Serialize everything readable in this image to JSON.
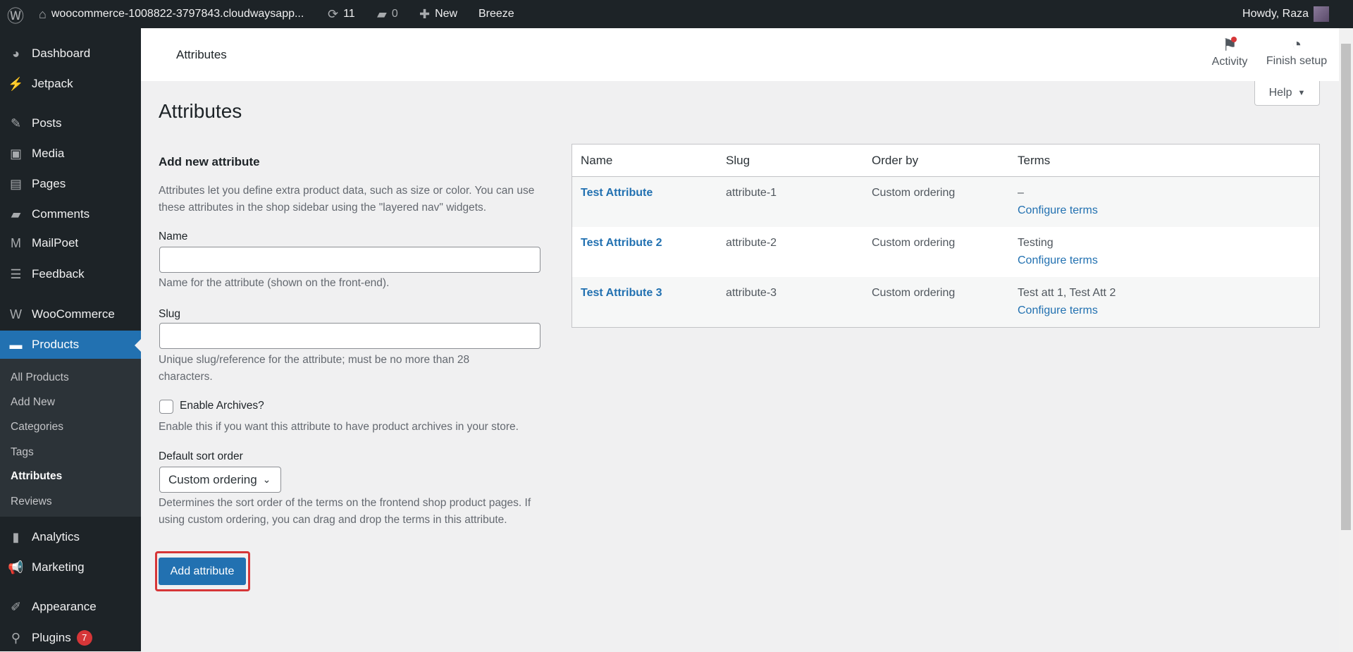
{
  "adminbar": {
    "site": "woocommerce-1008822-3797843.cloudwaysapp...",
    "updates": "11",
    "comments": "0",
    "new": "New",
    "breeze": "Breeze",
    "howdy": "Howdy, Raza"
  },
  "sidebar": {
    "items": [
      {
        "label": "Dashboard",
        "icon": "dashboard-icon",
        "glyph": "◕"
      },
      {
        "label": "Jetpack",
        "icon": "jetpack-icon",
        "glyph": "⚡"
      },
      {
        "label": "Posts",
        "icon": "pin-icon",
        "glyph": "✎"
      },
      {
        "label": "Media",
        "icon": "media-icon",
        "glyph": "▣"
      },
      {
        "label": "Pages",
        "icon": "pages-icon",
        "glyph": "▤"
      },
      {
        "label": "Comments",
        "icon": "comment-icon",
        "glyph": "▰"
      },
      {
        "label": "MailPoet",
        "icon": "mailpoet-icon",
        "glyph": "M"
      },
      {
        "label": "Feedback",
        "icon": "feedback-icon",
        "glyph": "☰"
      },
      {
        "label": "WooCommerce",
        "icon": "woo-icon",
        "glyph": "W"
      },
      {
        "label": "Products",
        "icon": "archive-icon",
        "glyph": "▬"
      },
      {
        "label": "Analytics",
        "icon": "chart-bar-icon",
        "glyph": "▮"
      },
      {
        "label": "Marketing",
        "icon": "megaphone-icon",
        "glyph": "📢"
      },
      {
        "label": "Appearance",
        "icon": "brush-icon",
        "glyph": "✐"
      },
      {
        "label": "Plugins",
        "icon": "plugin-icon",
        "glyph": "⚲",
        "badge": "7"
      }
    ],
    "submenu": [
      "All Products",
      "Add New",
      "Categories",
      "Tags",
      "Attributes",
      "Reviews"
    ]
  },
  "header": {
    "title": "Attributes",
    "activity": "Activity",
    "finish_setup": "Finish setup",
    "help": "Help"
  },
  "page": {
    "title": "Attributes"
  },
  "form": {
    "heading": "Add new attribute",
    "intro": "Attributes let you define extra product data, such as size or color. You can use these attributes in the shop sidebar using the \"layered nav\" widgets.",
    "name_label": "Name",
    "name_value": "",
    "name_help": "Name for the attribute (shown on the front-end).",
    "slug_label": "Slug",
    "slug_value": "",
    "slug_help": "Unique slug/reference for the attribute; must be no more than 28 characters.",
    "archives_label": "Enable Archives?",
    "archives_checked": false,
    "archives_help": "Enable this if you want this attribute to have product archives in your store.",
    "sort_label": "Default sort order",
    "sort_value": "Custom ordering",
    "sort_help": "Determines the sort order of the terms on the frontend shop product pages. If using custom ordering, you can drag and drop the terms in this attribute.",
    "submit": "Add attribute"
  },
  "table": {
    "headers": [
      "Name",
      "Slug",
      "Order by",
      "Terms"
    ],
    "rows": [
      {
        "name": "Test Attribute",
        "slug": "attribute-1",
        "order": "Custom ordering",
        "terms": "–",
        "configure": "Configure terms"
      },
      {
        "name": "Test Attribute 2",
        "slug": "attribute-2",
        "order": "Custom ordering",
        "terms": "Testing",
        "configure": "Configure terms"
      },
      {
        "name": "Test Attribute 3",
        "slug": "attribute-3",
        "order": "Custom ordering",
        "terms": "Test att 1, Test Att 2",
        "configure": "Configure terms"
      }
    ]
  },
  "colors": {
    "accent": "#2271b1",
    "sidebar": "#1d2327",
    "highlight": "#d63638"
  }
}
